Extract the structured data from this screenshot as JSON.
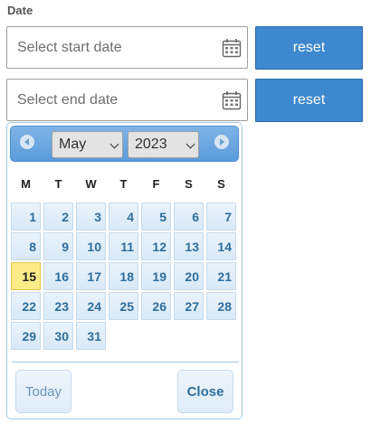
{
  "date_filter": {
    "label": "Date",
    "start_placeholder": "Select start date",
    "end_placeholder": "Select end date",
    "calendar_icon": "calendar-icon",
    "reset_label": "reset"
  },
  "datepicker": {
    "month": "May",
    "year": "2023",
    "prev_icon": "circle-triangle-left-icon",
    "next_icon": "circle-triangle-right-icon",
    "weekdays": [
      "M",
      "T",
      "W",
      "T",
      "F",
      "S",
      "S"
    ],
    "first_weekday_index": 0,
    "days": [
      "1",
      "2",
      "3",
      "4",
      "5",
      "6",
      "7",
      "8",
      "9",
      "10",
      "11",
      "12",
      "13",
      "14",
      "15",
      "16",
      "17",
      "18",
      "19",
      "20",
      "21",
      "22",
      "23",
      "24",
      "25",
      "26",
      "27",
      "28",
      "29",
      "30",
      "31"
    ],
    "highlighted_day": "15",
    "today_label": "Today",
    "close_label": "Close"
  },
  "colors": {
    "reset_button": "#3d88ce",
    "header": "#5a9bdb",
    "day_text": "#2e6e9e",
    "today_highlight": "#fbec88"
  }
}
